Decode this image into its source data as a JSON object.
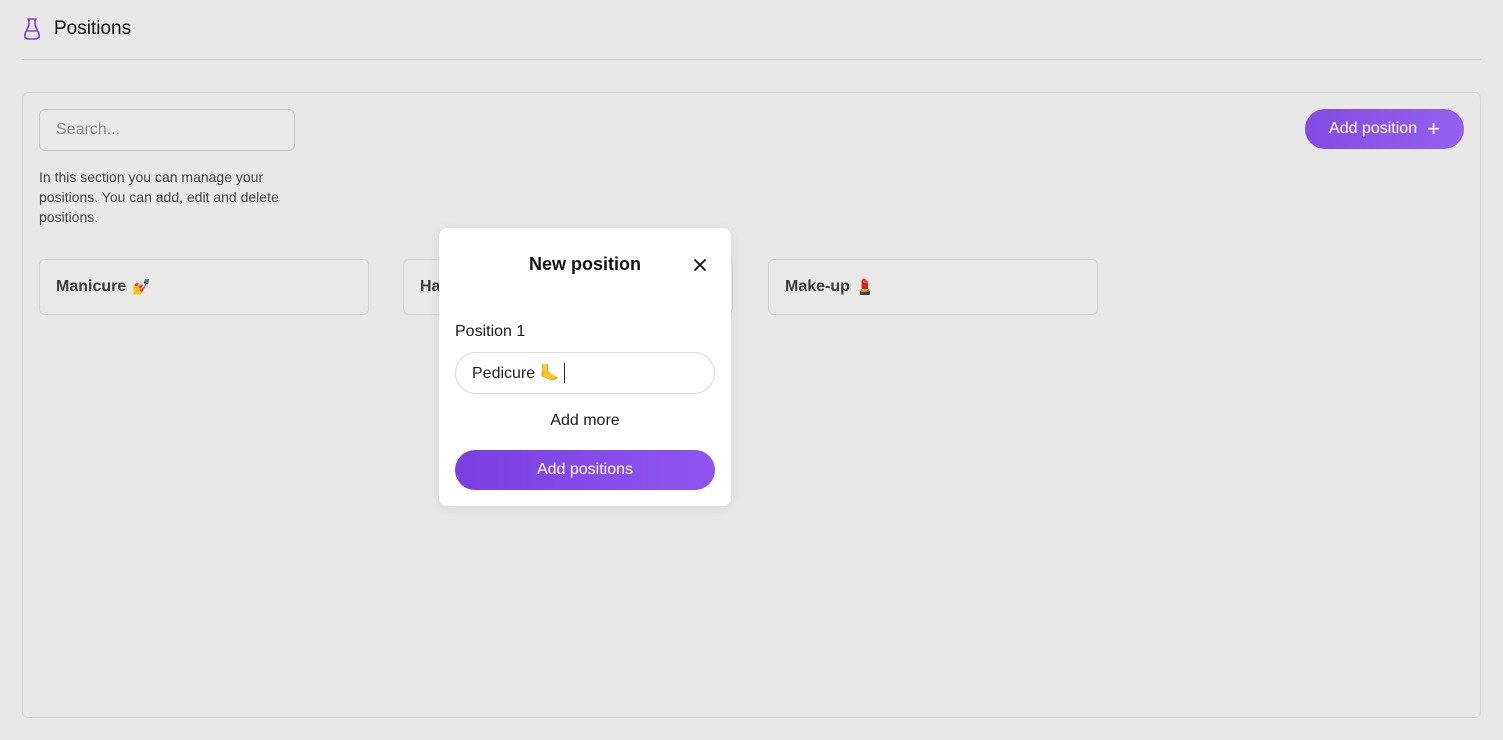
{
  "header": {
    "title": "Positions",
    "icon": "flask-icon"
  },
  "toolbar": {
    "search_placeholder": "Search...",
    "search_value": "",
    "add_position_label": "Add position",
    "add_position_icon": "plus-icon"
  },
  "description": "In this section you can manage your positions. You can add, edit and delete positions.",
  "positions": [
    {
      "label": "Manicure",
      "emoji": "💅"
    },
    {
      "label": "Ha",
      "emoji": ""
    },
    {
      "label": "Make-up",
      "emoji": "💄"
    }
  ],
  "modal": {
    "title": "New position",
    "close_icon": "close-icon",
    "field_label": "Position 1",
    "field_value": "Pedicure 🦶",
    "add_more_label": "Add more",
    "submit_label": "Add positions"
  },
  "colors": {
    "accent": "#7b3fe0",
    "background": "#e8e8e8"
  }
}
